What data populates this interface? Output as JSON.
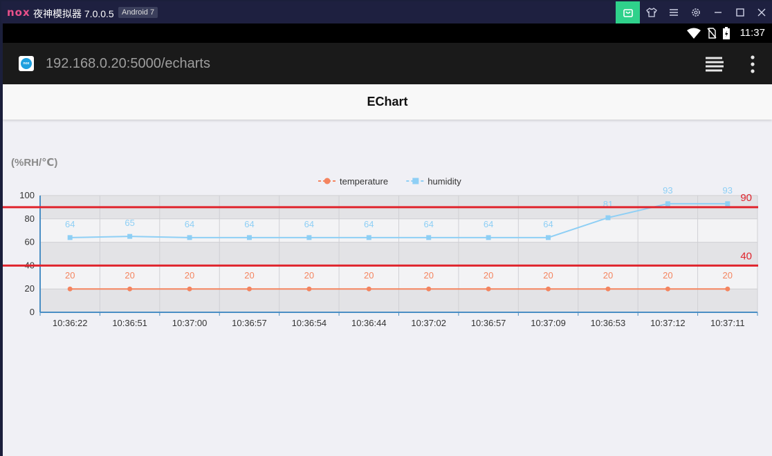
{
  "window": {
    "logo": "nox",
    "title": "夜神模拟器 7.0.0.5",
    "badge": "Android 7",
    "buttons": [
      "shop-icon",
      "shirt-icon",
      "menu-icon",
      "gear-icon",
      "minimize-icon",
      "maximize-icon",
      "close-icon"
    ],
    "accent": "#2fd18b"
  },
  "status_bar": {
    "time": "11:37",
    "icons": [
      "wifi-icon",
      "no-sim-icon",
      "battery-icon"
    ]
  },
  "browser": {
    "url": "192.168.0.20:5000/echarts",
    "icons": [
      "favicon-icon",
      "tabs-icon",
      "overflow-menu-icon"
    ]
  },
  "page": {
    "title": "EChart"
  },
  "chart_data": {
    "type": "line",
    "ylabel": "(%RH/℃)",
    "categories": [
      "10:36:22",
      "10:36:51",
      "10:37:00",
      "10:36:57",
      "10:36:54",
      "10:36:44",
      "10:37:02",
      "10:36:57",
      "10:37:09",
      "10:36:53",
      "10:37:12",
      "10:37:11"
    ],
    "series": [
      {
        "name": "temperature",
        "color": "#f4845f",
        "marker": "circle",
        "values": [
          20,
          20,
          20,
          20,
          20,
          20,
          20,
          20,
          20,
          20,
          20,
          20
        ]
      },
      {
        "name": "humidity",
        "color": "#8ecff5",
        "marker": "square",
        "values": [
          64,
          65,
          64,
          64,
          64,
          64,
          64,
          64,
          64,
          81,
          93,
          93
        ]
      }
    ],
    "mark_lines": [
      {
        "value": 90,
        "label": "90",
        "color": "#e0242d"
      },
      {
        "value": 40,
        "label": "40",
        "color": "#e0242d"
      }
    ],
    "ylim": [
      0,
      100
    ],
    "yticks": [
      0,
      20,
      40,
      60,
      80,
      100
    ],
    "legend_position": "top-center",
    "grid": true,
    "data_labels": true
  }
}
